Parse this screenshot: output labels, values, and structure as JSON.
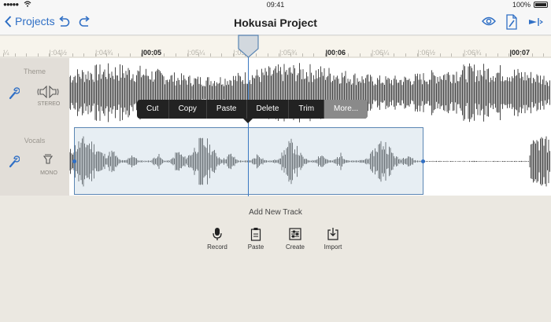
{
  "status": {
    "time": "09:41",
    "battery": "100%"
  },
  "nav": {
    "back_label": "Projects",
    "title": "Hokusai Project"
  },
  "ruler": {
    "labels": [
      {
        "text": "¼",
        "major": false
      },
      {
        "text": "|:04½",
        "major": false
      },
      {
        "text": "|:04¾",
        "major": false
      },
      {
        "text": "|00:05",
        "major": true
      },
      {
        "text": "|:05¼",
        "major": false
      },
      {
        "text": "|:05½",
        "major": false
      },
      {
        "text": "|:05¾",
        "major": false
      },
      {
        "text": "|00:06",
        "major": true
      },
      {
        "text": "|:06¼",
        "major": false
      },
      {
        "text": "|:06½",
        "major": false
      },
      {
        "text": "|:06¾",
        "major": false
      },
      {
        "text": "|00:07",
        "major": true
      }
    ]
  },
  "tracks": [
    {
      "name": "Theme",
      "type": "STEREO"
    },
    {
      "name": "Vocals",
      "type": "MONO"
    }
  ],
  "context_menu": [
    "Cut",
    "Copy",
    "Paste",
    "Delete",
    "Trim",
    "More..."
  ],
  "add_track": {
    "title": "Add New Track",
    "buttons": [
      {
        "label": "Record",
        "icon": "microphone-icon"
      },
      {
        "label": "Paste",
        "icon": "clipboard-icon"
      },
      {
        "label": "Create",
        "icon": "mixer-icon"
      },
      {
        "label": "Import",
        "icon": "import-icon"
      }
    ]
  },
  "colors": {
    "accent": "#2f6fc5",
    "waveform": "#4a4a4a",
    "selection": "#5b86b4"
  }
}
